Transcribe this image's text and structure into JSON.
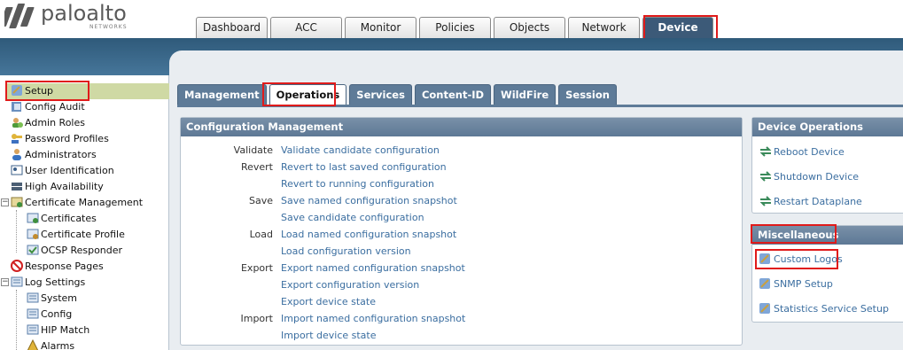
{
  "brand": {
    "name": "paloalto",
    "sub": "NETWORKS"
  },
  "top_tabs": [
    {
      "label": "Dashboard",
      "active": false
    },
    {
      "label": "ACC",
      "active": false
    },
    {
      "label": "Monitor",
      "active": false
    },
    {
      "label": "Policies",
      "active": false
    },
    {
      "label": "Objects",
      "active": false
    },
    {
      "label": "Network",
      "active": false
    },
    {
      "label": "Device",
      "active": true
    }
  ],
  "sidebar": {
    "items": [
      {
        "label": "Setup",
        "icon": "setup-icon",
        "selected": true
      },
      {
        "label": "Config Audit",
        "icon": "config-audit-icon"
      },
      {
        "label": "Admin Roles",
        "icon": "admin-roles-icon"
      },
      {
        "label": "Password Profiles",
        "icon": "key-icon"
      },
      {
        "label": "Administrators",
        "icon": "user-icon"
      },
      {
        "label": "User Identification",
        "icon": "id-card-icon"
      },
      {
        "label": "High Availability",
        "icon": "server-icon"
      },
      {
        "label": "Certificate Management",
        "icon": "certificate-icon",
        "expanded": true
      },
      {
        "label": "Certificates",
        "icon": "certificate-icon",
        "child": true
      },
      {
        "label": "Certificate Profile",
        "icon": "certificate-icon",
        "child": true
      },
      {
        "label": "OCSP Responder",
        "icon": "ocsp-icon",
        "child": true
      },
      {
        "label": "Response Pages",
        "icon": "response-pages-icon"
      },
      {
        "label": "Log Settings",
        "icon": "log-settings-icon",
        "expanded": true
      },
      {
        "label": "System",
        "icon": "log-icon",
        "child": true
      },
      {
        "label": "Config",
        "icon": "log-icon",
        "child": true
      },
      {
        "label": "HIP Match",
        "icon": "log-icon",
        "child": true
      },
      {
        "label": "Alarms",
        "icon": "alarm-icon",
        "child": true
      }
    ]
  },
  "sub_tabs": [
    {
      "label": "Management",
      "active": false
    },
    {
      "label": "Operations",
      "active": true
    },
    {
      "label": "Services",
      "active": false
    },
    {
      "label": "Content-ID",
      "active": false
    },
    {
      "label": "WildFire",
      "active": false
    },
    {
      "label": "Session",
      "active": false
    }
  ],
  "config_mgmt": {
    "title": "Configuration Management",
    "rows": [
      {
        "label": "Validate",
        "link": "Validate candidate configuration"
      },
      {
        "label": "Revert",
        "link": "Revert to last saved configuration"
      },
      {
        "label": "",
        "link": "Revert to running configuration"
      },
      {
        "label": "Save",
        "link": "Save named configuration snapshot"
      },
      {
        "label": "",
        "link": "Save candidate configuration"
      },
      {
        "label": "Load",
        "link": "Load named configuration snapshot"
      },
      {
        "label": "",
        "link": "Load configuration version"
      },
      {
        "label": "Export",
        "link": "Export named configuration snapshot"
      },
      {
        "label": "",
        "link": "Export configuration version"
      },
      {
        "label": "",
        "link": "Export device state"
      },
      {
        "label": "Import",
        "link": "Import named configuration snapshot"
      },
      {
        "label": "",
        "link": "Import device state"
      }
    ]
  },
  "device_ops": {
    "title": "Device Operations",
    "items": [
      {
        "label": "Reboot Device",
        "icon": "reboot-icon"
      },
      {
        "label": "Shutdown Device",
        "icon": "shutdown-icon"
      },
      {
        "label": "Restart Dataplane",
        "icon": "restart-icon"
      }
    ]
  },
  "misc": {
    "title": "Miscellaneous",
    "items": [
      {
        "label": "Custom Logos",
        "icon": "custom-logos-icon"
      },
      {
        "label": "SNMP Setup",
        "icon": "snmp-icon"
      },
      {
        "label": "Statistics Service Setup",
        "icon": "statistics-icon"
      }
    ]
  },
  "colors": {
    "accent": "#3c5a78",
    "link": "#3b6ea0",
    "highlight": "#e01b1b",
    "selected": "#cfd9a4"
  }
}
